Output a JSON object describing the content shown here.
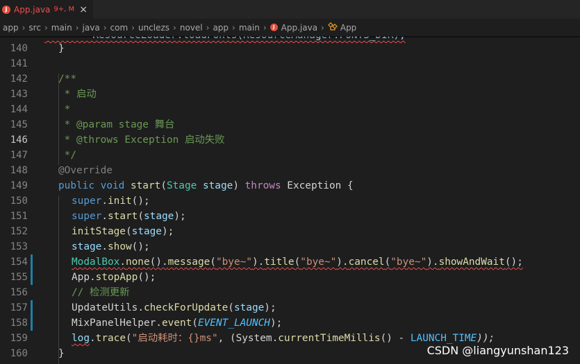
{
  "tab": {
    "icon_letter": "J",
    "name": "App.java",
    "status": "9+, M",
    "close": "×"
  },
  "breadcrumb": {
    "parts": [
      "app",
      "src",
      "main",
      "java",
      "com",
      "unclezs",
      "novel",
      "app",
      "main"
    ],
    "file": "App.java",
    "symbol": "App",
    "separator": "›"
  },
  "editor": {
    "top_partial_line": "        ResourceLoader.loadFonts(ResourceManager.FONTS_DIR);",
    "lines": [
      {
        "num": "140"
      },
      {
        "num": "141"
      },
      {
        "num": "142"
      },
      {
        "num": "143"
      },
      {
        "num": "144"
      },
      {
        "num": "145"
      },
      {
        "num": "146",
        "active": true
      },
      {
        "num": "147"
      },
      {
        "num": "148"
      },
      {
        "num": "149"
      },
      {
        "num": "150"
      },
      {
        "num": "151"
      },
      {
        "num": "152"
      },
      {
        "num": "153"
      },
      {
        "num": "154"
      },
      {
        "num": "155"
      },
      {
        "num": "156"
      },
      {
        "num": "157"
      },
      {
        "num": "158"
      },
      {
        "num": "159"
      },
      {
        "num": "160"
      }
    ],
    "tokens": {
      "brace_close": "}",
      "doc_open": "/**",
      "doc_start": " * 启动",
      "doc_star": " *",
      "doc_star_prefix": " * ",
      "param_tag": "@param",
      "param_text": " stage 舞台",
      "throws_tag": "@throws",
      "throws_text": " Exception 启动失败",
      "doc_close": " */",
      "override": "@Override",
      "public": "public",
      "void": "void",
      "start": "start",
      "stage_type": "Stage",
      "stage_param": "stage",
      "throws_kw": "throws",
      "exception": "Exception",
      "open_brace": " {",
      "super": "super",
      "init": "init",
      "initStage": "initStage",
      "show": "show",
      "modalbox": "ModalBox",
      "none": "none",
      "message": "message",
      "bye": "\"bye~\"",
      "title": "title",
      "cancel": "cancel",
      "showAndWait": "showAndWait",
      "app": "App",
      "stopApp": "stopApp",
      "check_comment": "// 检测更新",
      "updateUtils": "UpdateUtils",
      "checkForUpdate": "checkForUpdate",
      "mixPanel": "MixPanelHelper",
      "event": "event",
      "event_launch": "EVENT_LAUNCH",
      "log": "log",
      "trace": "trace",
      "trace_str": "\"启动耗时：{}ms\"",
      "system": "System",
      "currentTimeMillis": "currentTimeMillis",
      "launch_time": "LAUNCH_TIM",
      "launch_time_tail": "E",
      "end_paren": "));"
    }
  },
  "watermark": "CSDN @liangyunshan123"
}
